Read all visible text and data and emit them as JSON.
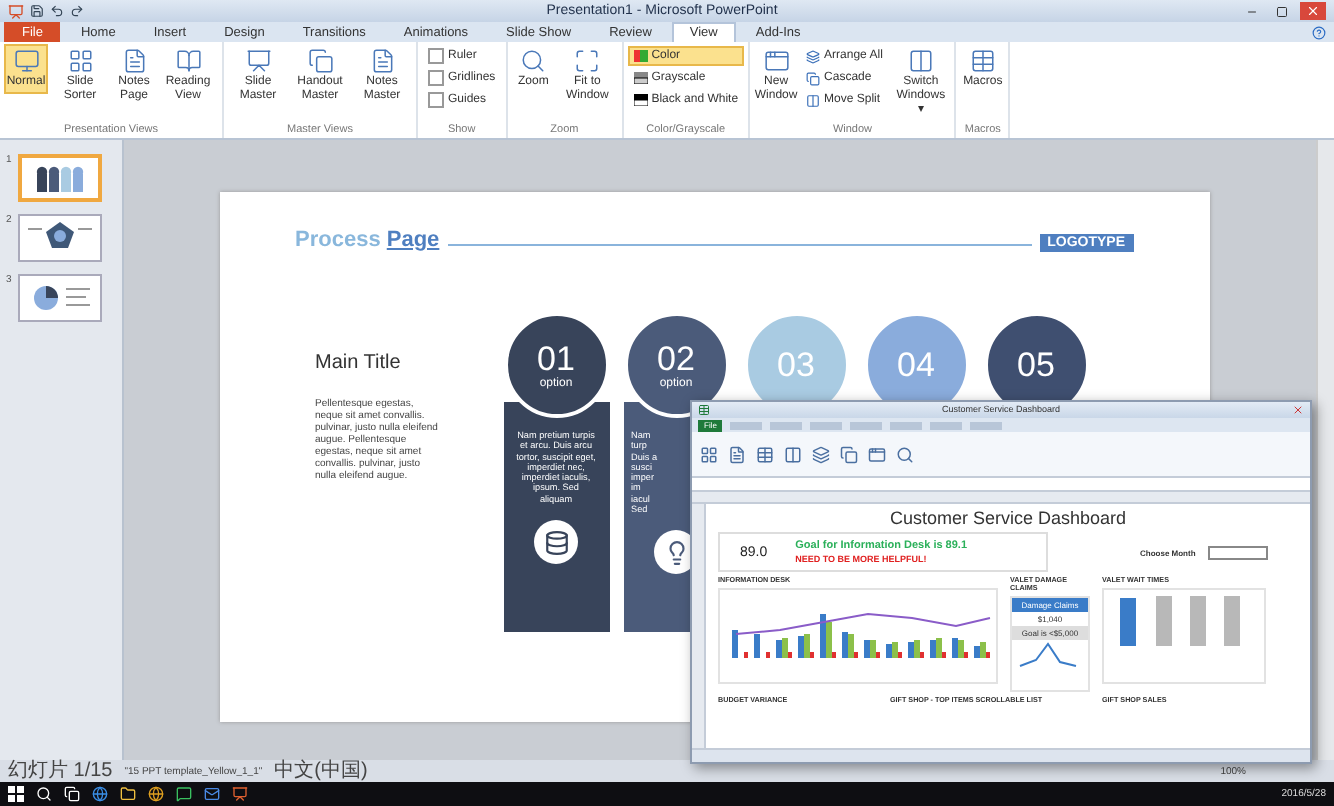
{
  "window": {
    "title": "Presentation1 - Microsoft PowerPoint"
  },
  "tabs": [
    {
      "label": "File",
      "selected": false,
      "kind": "file"
    },
    {
      "label": "Home",
      "selected": false,
      "kind": "tab"
    },
    {
      "label": "Insert",
      "selected": false,
      "kind": "tab"
    },
    {
      "label": "Design",
      "selected": false,
      "kind": "tab"
    },
    {
      "label": "Transitions",
      "selected": false,
      "kind": "tab"
    },
    {
      "label": "Animations",
      "selected": false,
      "kind": "tab"
    },
    {
      "label": "Slide Show",
      "selected": false,
      "kind": "tab"
    },
    {
      "label": "Review",
      "selected": false,
      "kind": "tab"
    },
    {
      "label": "View",
      "selected": true,
      "kind": "tab"
    },
    {
      "label": "Add-Ins",
      "selected": false,
      "kind": "tab"
    }
  ],
  "ribbon": {
    "groups": [
      {
        "label": "Presentation Views",
        "items": [
          {
            "kind": "large",
            "label": "Normal",
            "selected": true
          },
          {
            "kind": "large",
            "label": "Slide Sorter",
            "selected": false
          },
          {
            "kind": "large",
            "label": "Notes Page",
            "selected": false
          },
          {
            "kind": "large",
            "label": "Reading View",
            "selected": false
          }
        ]
      },
      {
        "label": "Master Views",
        "items": [
          {
            "kind": "large",
            "label": "Slide Master",
            "selected": false
          },
          {
            "kind": "large",
            "label": "Handout Master",
            "selected": false
          },
          {
            "kind": "large",
            "label": "Notes Master",
            "selected": false
          }
        ]
      },
      {
        "label": "Show",
        "items": [
          {
            "kind": "check",
            "label": "Ruler",
            "checked": false
          },
          {
            "kind": "check",
            "label": "Gridlines",
            "checked": false
          },
          {
            "kind": "check",
            "label": "Guides",
            "checked": false
          }
        ]
      },
      {
        "label": "Zoom",
        "items": [
          {
            "kind": "large",
            "label": "Zoom",
            "selected": false
          },
          {
            "kind": "large",
            "label": "Fit to Window",
            "selected": false
          }
        ]
      },
      {
        "label": "Color/Grayscale",
        "items": [
          {
            "kind": "small",
            "label": "Color",
            "selected": true
          },
          {
            "kind": "small",
            "label": "Grayscale",
            "selected": false
          },
          {
            "kind": "small",
            "label": "Black and White",
            "selected": false
          }
        ]
      },
      {
        "label": "Window",
        "items": [
          {
            "kind": "large",
            "label": "New Window",
            "selected": false
          },
          {
            "kind": "small",
            "label": "Arrange All",
            "selected": false
          },
          {
            "kind": "small",
            "label": "Cascade",
            "selected": false
          },
          {
            "kind": "small",
            "label": "Move Split",
            "selected": false
          },
          {
            "kind": "large",
            "label": "Switch Windows ▾",
            "selected": false
          }
        ]
      },
      {
        "label": "Macros",
        "items": [
          {
            "kind": "large",
            "label": "Macros",
            "selected": false
          }
        ]
      }
    ]
  },
  "thumbnails": [
    {
      "number": "1",
      "selected": true
    },
    {
      "number": "2",
      "selected": false
    },
    {
      "number": "3",
      "selected": false
    }
  ],
  "slide": {
    "heading_light": "Process",
    "heading_bold": "Page",
    "logotype": "LOGOTYPE",
    "main_title": "Main Title",
    "body": "Pellentesque egestas, neque sit amet convallis. pulvinar, justo nulla eleifend augue. Pellentesque egestas, neque sit amet convallis. pulvinar, justo nulla eleifend augue.",
    "steps": [
      {
        "kind": "full",
        "number": "01",
        "label": "option",
        "text": "Nam pretium turpis et arcu. Duis arcu tortor, suscipit eget, imperdiet nec, imperdiet iaculis, ipsum. Sed aliquam",
        "color": "#38445a"
      },
      {
        "kind": "clipped",
        "number": "02",
        "label": "option",
        "text_lines": [
          "Nam",
          "turp",
          "Duis a",
          "susci",
          "imper",
          "im",
          "iacul",
          "Sed"
        ],
        "color": "#4b5b7a"
      },
      {
        "kind": "top",
        "number": "03",
        "color": "#a9cbe2"
      },
      {
        "kind": "top",
        "number": "04",
        "color": "#8aacdc"
      },
      {
        "kind": "top",
        "number": "05",
        "color": "#3f4f70"
      }
    ]
  },
  "excel": {
    "title": "Customer Service Dashboard",
    "file_tab": "File",
    "dashboard": {
      "heading": "Customer Service Dashboard",
      "score": "89.0",
      "goal": "Goal for Information Desk is 89.1",
      "alert": "NEED TO BE MORE HELPFUL!",
      "month_label": "Choose Month",
      "info_desk": "INFORMATION DESK",
      "damage_title": "VALET DAMAGE CLAIMS",
      "damage_label": "Damage Claims",
      "damage_value": "$1,040",
      "damage_goal": "Goal is <$5,000",
      "wait_title": "VALET WAIT TIMES",
      "budget_title": "BUDGET VARIANCE",
      "gift_title": "GIFT SHOP - TOP ITEMS  SCROLLABLE LIST",
      "gift_sales_title": "GIFT SHOP SALES"
    }
  },
  "status_bar": {
    "slide": "幻灯片 1/15",
    "file": "\"15 PPT template_Yellow_1_1\"",
    "language": "中文(中国)",
    "zoom": "100%"
  },
  "taskbar": {
    "clock": "2016/5/28"
  }
}
